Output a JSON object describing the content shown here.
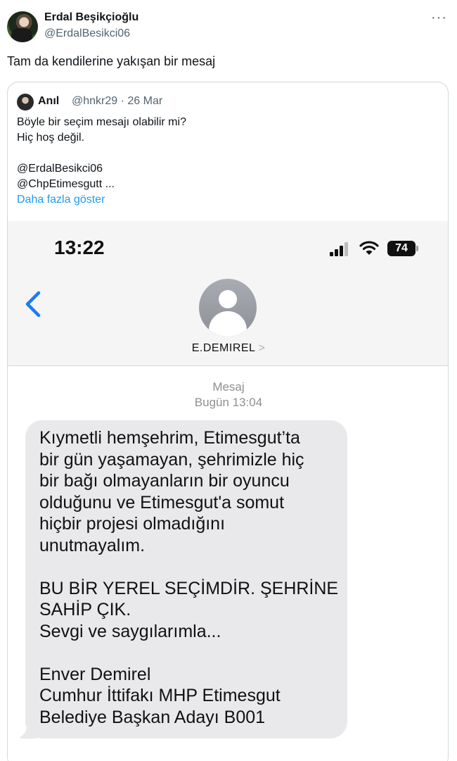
{
  "tweet": {
    "author_name": "Erdal Beşikçioğlu",
    "author_handle": "@ErdalBesikci06",
    "more_icon": "more-horizontal-icon",
    "text": "Tam da kendilerine yakışan bir mesaj"
  },
  "quote": {
    "author_name": "Anıl",
    "author_handle": "@hnkr29 · 26 Mar",
    "lines": [
      "Böyle bir seçim mesajı olabilir mi?",
      "Hiç hoş değil.",
      "",
      "@ErdalBesikci06",
      "@ChpEtimesgutt ..."
    ],
    "show_more": "Daha fazla göster"
  },
  "phone": {
    "time": "13:22",
    "battery": "74",
    "contact_name": "E.DEMIREL",
    "contact_chevron": ">",
    "msg_label": "Mesaj",
    "msg_time": "Bugün 13:04",
    "message_lines": [
      "Kıymetli hemşehrim, Etimesgut’ta",
      "bir gün yaşamayan, şehrimizle hiç",
      "bir bağı olmayanların bir oyuncu",
      "olduğunu ve Etimesgut'a somut",
      "hiçbir projesi olmadığını",
      "unutmayalım.",
      "",
      "BU BİR YEREL SEÇİMDİR.  ŞEHRİNE",
      "SAHİP ÇIK.",
      "Sevgi ve saygılarımla...",
      "",
      "Enver Demirel",
      "Cumhur İttifakı MHP Etimesgut",
      "Belediye Başkan Adayı B001"
    ]
  }
}
